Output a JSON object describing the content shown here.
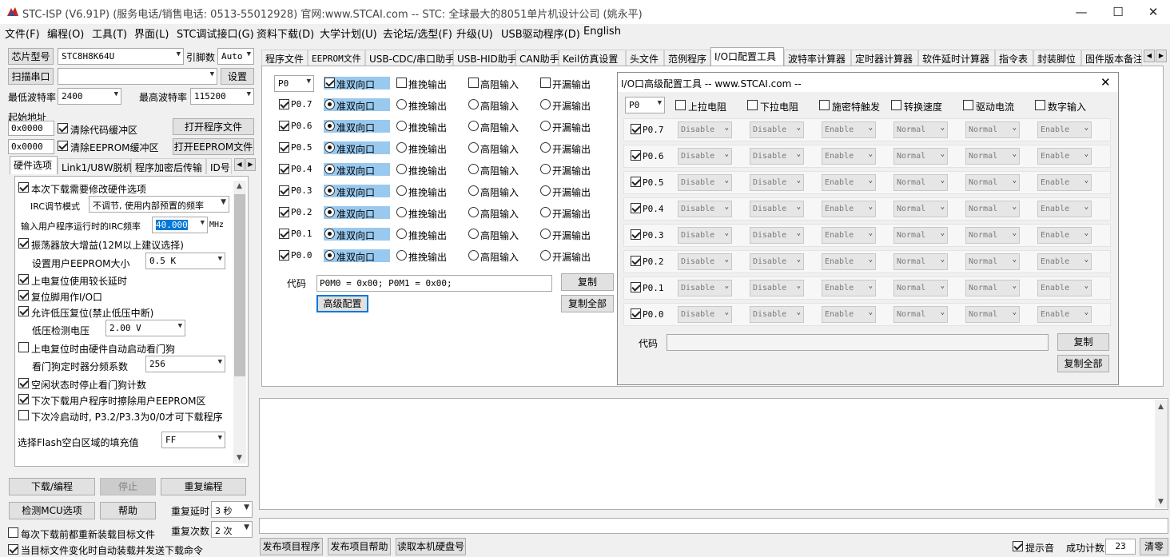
{
  "window": {
    "title": "STC-ISP (V6.91P) (服务电话/销售电话: 0513-55012928) 官网:www.STCAI.com  -- STC: 全球最大的8051单片机设计公司 (姚永平)",
    "minimize": "—",
    "maximize": "☐",
    "close": "✕"
  },
  "menu": [
    "文件(F)",
    "编程(O)",
    "工具(T)",
    "界面(L)",
    "STC调试接口(G)",
    "资料下载(D)",
    "大学计划(U)",
    "去论坛/选型(F)",
    "升级(U)",
    "USB驱动程序(D)",
    "English"
  ],
  "left": {
    "chip_label": "芯片型号",
    "chip_value": "STC8H8K64U",
    "pin_label": "引脚数",
    "pin_value": "Auto",
    "scan_btn": "扫描串口",
    "port_value": "",
    "settings_btn": "设置",
    "min_baud_label": "最低波特率",
    "min_baud": "2400",
    "max_baud_label": "最高波特率",
    "max_baud": "115200",
    "start_addr_label": "起始地址",
    "addr1": "0x0000",
    "clear_code": "清除代码缓冲区",
    "open_prog": "打开程序文件",
    "addr2": "0x0000",
    "clear_eeprom": "清除EEPROM缓冲区",
    "open_eeprom": "打开EEPROM文件",
    "tabs": [
      "硬件选项",
      "Link1/U8W脱机",
      "程序加密后传输",
      "ID号"
    ],
    "opts": {
      "o1": "本次下载需要修改硬件选项",
      "irc_mode_label": "IRC调节模式",
      "irc_mode": "不调节, 使用内部预置的频率",
      "irc_freq_label": "输入用户程序运行时的IRC频率",
      "irc_freq": "40.000",
      "mhz": "MHz",
      "o2": "振荡器放大增益(12M以上建议选择)",
      "eeprom_size_label": "设置用户EEPROM大小",
      "eeprom_size": "0.5 K",
      "o3": "上电复位使用较长延时",
      "o4": "复位脚用作I/O口",
      "o5": "允许低压复位(禁止低压中断)",
      "lvd_label": "低压检测电压",
      "lvd": "2.00 V",
      "o6": "上电复位时由硬件自动启动看门狗",
      "wdt_label": "看门狗定时器分频系数",
      "wdt": "256",
      "o7": "空闲状态时停止看门狗计数",
      "o8": "下次下载用户程序时擦除用户EEPROM区",
      "o9": "下次冷启动时, P3.2/P3.3为0/0才可下载程序",
      "fill_label": "选择Flash空白区域的填充值",
      "fill": "FF"
    },
    "download_btn": "下载/编程",
    "stop_btn": "停止",
    "reprog_btn": "重复编程",
    "check_mcu_btn": "检测MCU选项",
    "help_btn": "帮助",
    "repeat_delay_label": "重复延时",
    "repeat_delay": "3 秒",
    "repeat_count_label": "重复次数",
    "repeat_count": "2 次",
    "reload_label": "每次下载前都重新装载目标文件",
    "auto_label": "当目标文件变化时自动装载并发送下载命令"
  },
  "right_tabs": [
    "程序文件",
    "EEPROM文件",
    "USB-CDC/串口助手",
    "USB-HID助手",
    "CAN助手",
    "Keil仿真设置",
    "头文件",
    "范例程序",
    "I/O口配置工具",
    "波特率计算器",
    "定时器计算器",
    "软件延时计算器",
    "指令表",
    "封装脚位",
    "固件版本备注"
  ],
  "io": {
    "port": "P0",
    "mode_headers": [
      "准双向口",
      "推挽输出",
      "高阻输入",
      "开漏输出"
    ],
    "pins": [
      "P0.7",
      "P0.6",
      "P0.5",
      "P0.4",
      "P0.3",
      "P0.2",
      "P0.1",
      "P0.0"
    ],
    "code_label": "代码",
    "code_value": "P0M0 = 0x00; P0M1 = 0x00;",
    "copy_btn": "复制",
    "advanced_btn": "高级配置",
    "copy_all_btn": "复制全部"
  },
  "adv": {
    "title": "I/O口高级配置工具 -- www.STCAI.com --",
    "close": "✕",
    "port": "P0",
    "headers": [
      "上拉电阻",
      "下拉电阻",
      "施密特触发",
      "转换速度",
      "驱动电流",
      "数字输入"
    ],
    "rows": [
      {
        "pin": "P0.7",
        "values": [
          "Disable",
          "Disable",
          "Enable",
          "Normal",
          "Normal",
          "Enable"
        ]
      },
      {
        "pin": "P0.6",
        "values": [
          "Disable",
          "Disable",
          "Enable",
          "Normal",
          "Normal",
          "Enable"
        ]
      },
      {
        "pin": "P0.5",
        "values": [
          "Disable",
          "Disable",
          "Enable",
          "Normal",
          "Normal",
          "Enable"
        ]
      },
      {
        "pin": "P0.4",
        "values": [
          "Disable",
          "Disable",
          "Enable",
          "Normal",
          "Normal",
          "Enable"
        ]
      },
      {
        "pin": "P0.3",
        "values": [
          "Disable",
          "Disable",
          "Enable",
          "Normal",
          "Normal",
          "Enable"
        ]
      },
      {
        "pin": "P0.2",
        "values": [
          "Disable",
          "Disable",
          "Enable",
          "Normal",
          "Normal",
          "Enable"
        ]
      },
      {
        "pin": "P0.1",
        "values": [
          "Disable",
          "Disable",
          "Enable",
          "Normal",
          "Normal",
          "Enable"
        ]
      },
      {
        "pin": "P0.0",
        "values": [
          "Disable",
          "Disable",
          "Enable",
          "Normal",
          "Normal",
          "Enable"
        ]
      }
    ],
    "code_label": "代码",
    "code_value": "",
    "copy_btn": "复制",
    "copy_all_btn": "复制全部"
  },
  "bottom": {
    "publish_prog": "发布项目程序",
    "publish_help": "发布项目帮助",
    "read_disk": "读取本机硬盘号",
    "sound_label": "提示音",
    "success_label": "成功计数",
    "success_count": "23",
    "clear_btn": "清零"
  }
}
